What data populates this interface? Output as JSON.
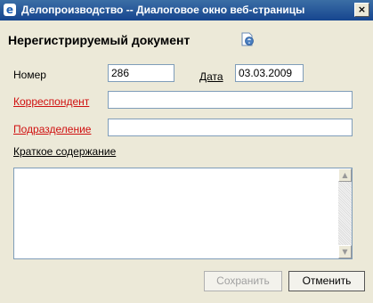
{
  "window": {
    "title": "Делопроизводство -- Диалоговое окно веб-страницы",
    "close_label": "×"
  },
  "form": {
    "heading": "Нерегистрируемый документ",
    "number_label": "Номер",
    "number_value": "286",
    "date_label": "Дата",
    "date_value": "03.03.2009",
    "correspondent_label": "Корреспондент",
    "correspondent_value": "",
    "department_label": "Подразделение",
    "department_value": "",
    "summary_label": "Краткое содержание",
    "summary_value": ""
  },
  "buttons": {
    "save": "Сохранить",
    "cancel": "Отменить",
    "save_enabled": false
  },
  "colors": {
    "titlebar": "#16458f",
    "link_red": "#d01010",
    "window_bg": "#ece9d8"
  },
  "icons": {
    "window_icon": "ie-icon",
    "help_icon": "document-help-icon"
  }
}
